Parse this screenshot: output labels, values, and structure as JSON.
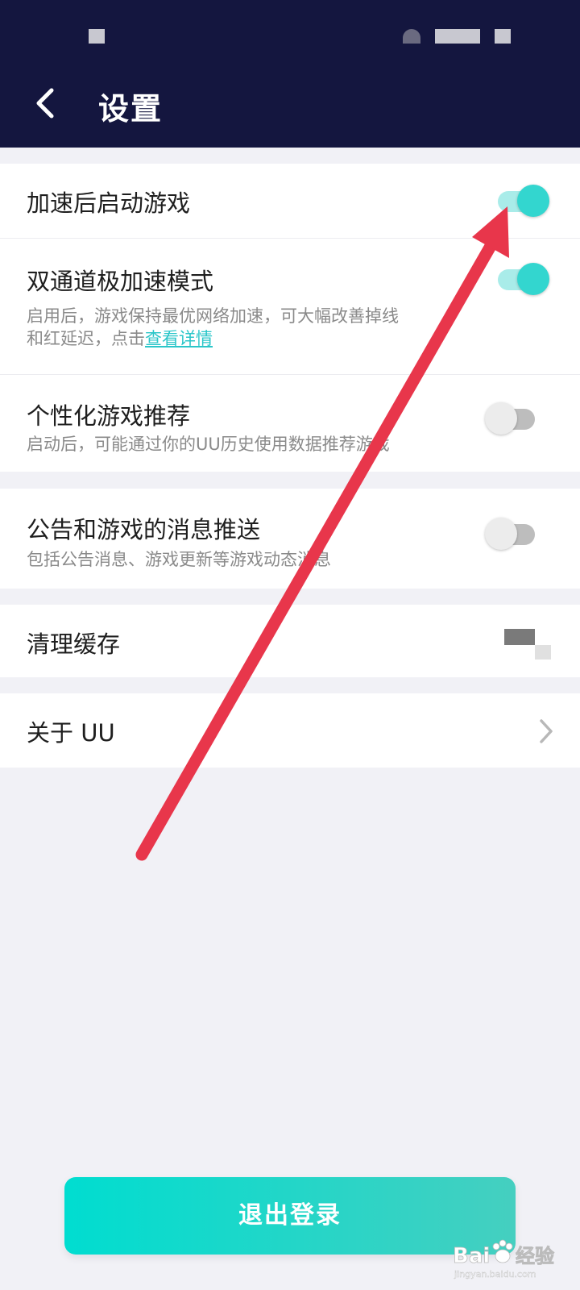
{
  "header": {
    "title": "设置"
  },
  "settings": {
    "launch_after_speedup": {
      "title": "加速后启动游戏",
      "enabled": true
    },
    "dual_channel": {
      "title": "双通道极加速模式",
      "desc_line1": "启用后，游戏保持最优网络加速，可大幅改善掉线",
      "desc_line2": "和红延迟，点击",
      "link": "查看详情",
      "enabled": true
    },
    "personalized": {
      "title": "个性化游戏推荐",
      "desc": "启动后，可能通过你的UU历史使用数据推荐游戏",
      "enabled": false
    },
    "notifications": {
      "title": "公告和游戏的消息推送",
      "desc": "包括公告消息、游戏更新等游戏动态消息",
      "enabled": false
    },
    "clear_cache": {
      "title": "清理缓存"
    },
    "about": {
      "title": "关于 UU"
    }
  },
  "logout_button": {
    "label": "退出登录"
  },
  "watermark": {
    "brand": "Bai",
    "brand_suffix": "经验",
    "url": "jingyan.baidu.com"
  },
  "colors": {
    "header_bg": "#14163f",
    "accent": "#33d6cf",
    "arrow": "#e8364b",
    "link": "#2bc6c9"
  },
  "icons": {
    "back": "chevron-left-icon",
    "about": "chevron-right-icon"
  }
}
